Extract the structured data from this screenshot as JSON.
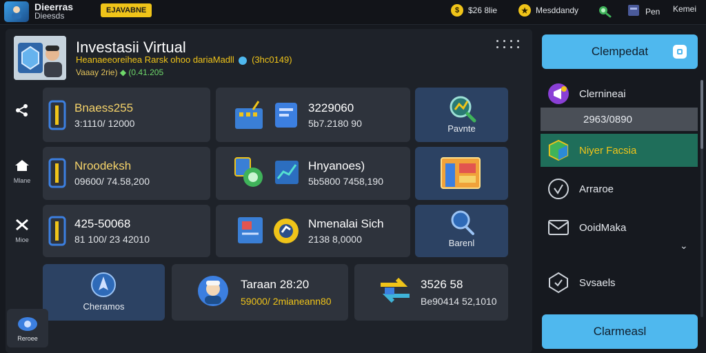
{
  "app": {
    "title": "Dieerras",
    "subtitle": "Dieesds",
    "badge": "EJAVABNE"
  },
  "topbar": {
    "coins": "$26 8lie",
    "mastery": "Mesddandy",
    "profile": "Pen",
    "menu": "Kemei"
  },
  "header": {
    "title": "Investasii Virtual",
    "subtitle": "Heanaeeoreihea Rarsk ohoo dariaMadll",
    "subtitle_code": "(3hc0149)",
    "line2_prefix": "Vaaay 2rie)",
    "line2_value": "(0.41.205"
  },
  "side_nav": [
    {
      "label": ""
    },
    {
      "label": "Mlane"
    },
    {
      "label": "Mioe"
    }
  ],
  "cards": {
    "c1": {
      "title": "Bnaess255",
      "value": "3:1110/ 12000"
    },
    "c2": {
      "title": "3229060",
      "value": "5b7.2180 90"
    },
    "c3": {
      "label": "Pavnte"
    },
    "c4": {
      "title": "Nroodeksh",
      "value": "09600/ 74.58,200"
    },
    "c5": {
      "title": "Hnyanoes)",
      "value": "5b5800 7458,190"
    },
    "c7": {
      "title": "425-50068",
      "value": "81 100/ 23 42010"
    },
    "c8": {
      "title": "Nmenalai Sich",
      "value": "2138 8,0000"
    },
    "c9": {
      "label": "Barenl"
    },
    "c10": {
      "label": "Cheramos"
    },
    "c11": {
      "title": "Taraan 28:20",
      "value": "59000/ 2mianeann80"
    },
    "c12": {
      "title": "3526 58",
      "value": "Be90414 52,1010"
    }
  },
  "bottom_left": {
    "label": "Reroee"
  },
  "right_panel": {
    "top_button": "Clempedat",
    "items": [
      {
        "label": "Clernineai"
      },
      {
        "label": "2963/0890"
      },
      {
        "label": "Niyer Facsia"
      },
      {
        "label": "Arraroe"
      },
      {
        "label": "OoidMaka"
      },
      {
        "label": "Svsaels"
      }
    ],
    "bottom_button": "Clarmeasl"
  },
  "colors": {
    "accent_yellow": "#f0c419",
    "accent_blue": "#4fb8ee",
    "card_bg": "#2e333c",
    "card_blue": "#2c4263",
    "highlight_green": "#1f6e5a",
    "highlight_gray": "#4a4f57"
  },
  "icons": {
    "coin": "coin-icon",
    "mastery": "star-coin-icon",
    "search": "search-icon",
    "profile": "profile-icon"
  }
}
